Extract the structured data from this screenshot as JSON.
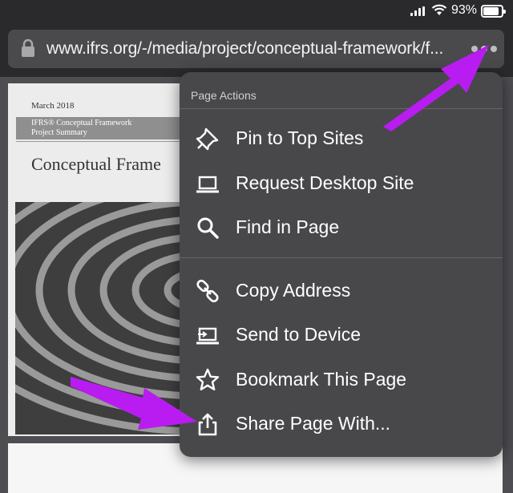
{
  "status_bar": {
    "battery_text": "93%"
  },
  "browser": {
    "url": "www.ifrs.org/-/media/project/conceptual-framework/f..."
  },
  "document": {
    "date": "March 2018",
    "band_line1": "IFRS® Conceptual Framework",
    "band_line2": "Project Summary",
    "heading": "Conceptual Frame"
  },
  "menu": {
    "header": "Page Actions",
    "items": [
      {
        "label": "Pin to Top Sites",
        "icon": "pin-icon"
      },
      {
        "label": "Request Desktop Site",
        "icon": "laptop-icon"
      },
      {
        "label": "Find in Page",
        "icon": "search-icon"
      },
      {
        "label": "Copy Address",
        "icon": "link-icon"
      },
      {
        "label": "Send to Device",
        "icon": "send-to-device-icon"
      },
      {
        "label": "Bookmark This Page",
        "icon": "star-icon"
      },
      {
        "label": "Share Page With...",
        "icon": "share-icon"
      }
    ]
  },
  "colors": {
    "accent_arrow": "#b81cf0",
    "menu_bg": "#48484b",
    "url_bar_bg": "#4a4a4d"
  }
}
